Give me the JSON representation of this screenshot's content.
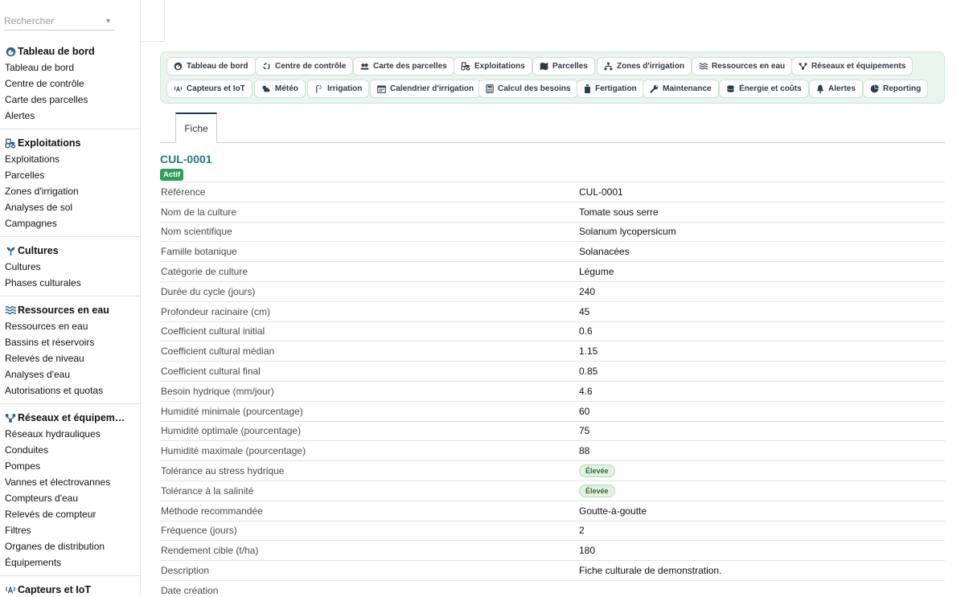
{
  "search": {
    "placeholder": "Rechercher"
  },
  "sidebar": {
    "sections": [
      {
        "title": "Tableau de bord",
        "icon": "gauge-icon",
        "items": [
          "Tableau de bord",
          "Centre de contrôle",
          "Carte des parcelles",
          "Alertes"
        ]
      },
      {
        "title": "Exploitations",
        "icon": "tractor-icon",
        "items": [
          "Exploitations",
          "Parcelles",
          "Zones d'irrigation",
          "Analyses de sol",
          "Campagnes"
        ]
      },
      {
        "title": "Cultures",
        "icon": "seedling-icon",
        "items": [
          "Cultures",
          "Phases culturales"
        ]
      },
      {
        "title": "Ressources en eau",
        "icon": "water-icon",
        "items": [
          "Ressources en eau",
          "Bassins et réservoirs",
          "Relevés de niveau",
          "Analyses d'eau",
          "Autorisations et quotas"
        ]
      },
      {
        "title": "Réseaux et équipem…",
        "icon": "network-icon",
        "items": [
          "Réseaux hydrauliques",
          "Conduites",
          "Pompes",
          "Vannes et électrovannes",
          "Compteurs d'eau",
          "Relevés de compteur",
          "Filtres",
          "Organes de distribution",
          "Équipements"
        ]
      },
      {
        "title": "Capteurs et IoT",
        "icon": "sensor-icon",
        "items": []
      }
    ]
  },
  "nav": {
    "row1": [
      "Tableau de bord",
      "Centre de contrôle",
      "Carte des parcelles",
      "Exploitations",
      "Parcelles",
      "Zones d'irrigation",
      "Ressources en eau",
      "Réseaux et équipements"
    ],
    "row2": [
      "Capteurs et IoT",
      "Météo",
      "Irrigation",
      "Calendrier d'irrigation",
      "Calcul des besoins",
      "Fertigation",
      "Maintenance",
      "Énergie et coûts",
      "Alertes",
      "Reporting"
    ]
  },
  "tabs": {
    "fiche": "Fiche"
  },
  "record": {
    "title": "CUL-0001",
    "status": "Actif",
    "fields": [
      {
        "label": "Référence",
        "value": "CUL-0001"
      },
      {
        "label": "Nom de la culture",
        "value": "Tomate sous serre"
      },
      {
        "label": "Nom scientifique",
        "value": "Solanum lycopersicum"
      },
      {
        "label": "Famille botanique",
        "value": "Solanacées"
      },
      {
        "label": "Catégorie de culture",
        "value": "Légume"
      },
      {
        "label": "Durée du cycle (jours)",
        "value": "240"
      },
      {
        "label": "Profondeur racinaire (cm)",
        "value": "45"
      },
      {
        "label": "Coefficient cultural initial",
        "value": "0.6"
      },
      {
        "label": "Coefficient cultural médian",
        "value": "1.15"
      },
      {
        "label": "Coefficient cultural final",
        "value": "0.85"
      },
      {
        "label": "Besoin hydrique (mm/jour)",
        "value": "4.6"
      },
      {
        "label": "Humidité minimale (pourcentage)",
        "value": "60"
      },
      {
        "label": "Humidité optimale (pourcentage)",
        "value": "75"
      },
      {
        "label": "Humidité maximale (pourcentage)",
        "value": "88"
      },
      {
        "label": "Tolérance au stress hydrique",
        "value": "Élevée"
      },
      {
        "label": "Tolérance à la salinité",
        "value": "Élevée"
      },
      {
        "label": "Méthode recommandée",
        "value": "Goutte-à-goutte"
      },
      {
        "label": "Fréquence (jours)",
        "value": "2"
      },
      {
        "label": "Rendement cible (t/ha)",
        "value": "180"
      },
      {
        "label": "Description",
        "value": "Fiche culturale de demonstration."
      },
      {
        "label": "Date création",
        "value": ""
      }
    ]
  },
  "colors": {
    "accent": "#1c7a86",
    "badge": "#2e9e5b",
    "nav_bg": "#e8f6ef",
    "icon": "#1f5f8f"
  }
}
